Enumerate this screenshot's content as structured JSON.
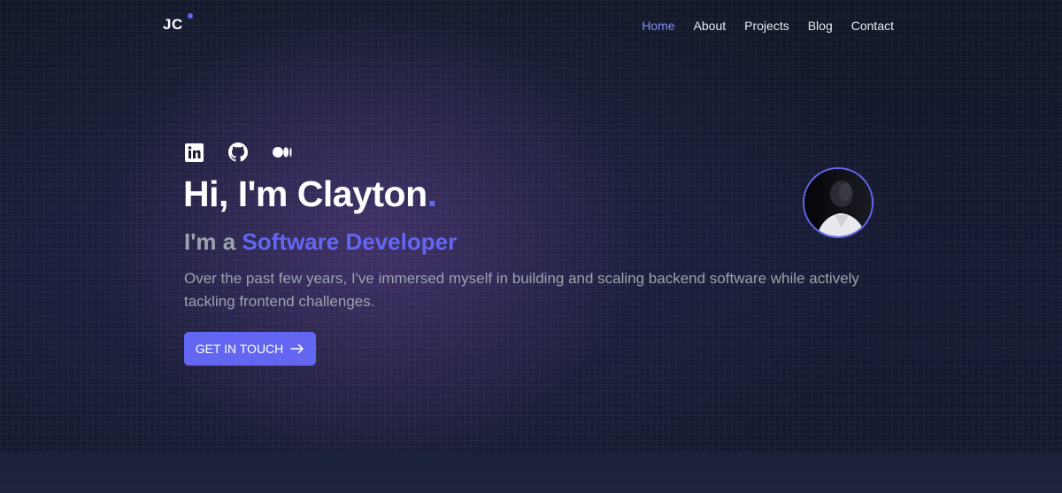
{
  "header": {
    "logo_text": "JC",
    "nav": [
      {
        "label": "Home",
        "active": true
      },
      {
        "label": "About",
        "active": false
      },
      {
        "label": "Projects",
        "active": false
      },
      {
        "label": "Blog",
        "active": false
      },
      {
        "label": "Contact",
        "active": false
      }
    ]
  },
  "socials": [
    {
      "icon": "linkedin-icon"
    },
    {
      "icon": "github-icon"
    },
    {
      "icon": "medium-icon"
    }
  ],
  "hero": {
    "greeting": "Hi, I'm Clayton",
    "greeting_dot": ".",
    "subtitle_prefix": "I'm a ",
    "role": "Software Developer",
    "description": "Over the past few years, I've immersed myself in building and scaling backend software while actively tackling frontend challenges.",
    "cta_label": "GET IN TOUCH",
    "cta_icon": "arrow-right-icon"
  },
  "colors": {
    "accent": "#6366f1",
    "background": "#151a2e",
    "text_muted": "#9ca3af"
  }
}
